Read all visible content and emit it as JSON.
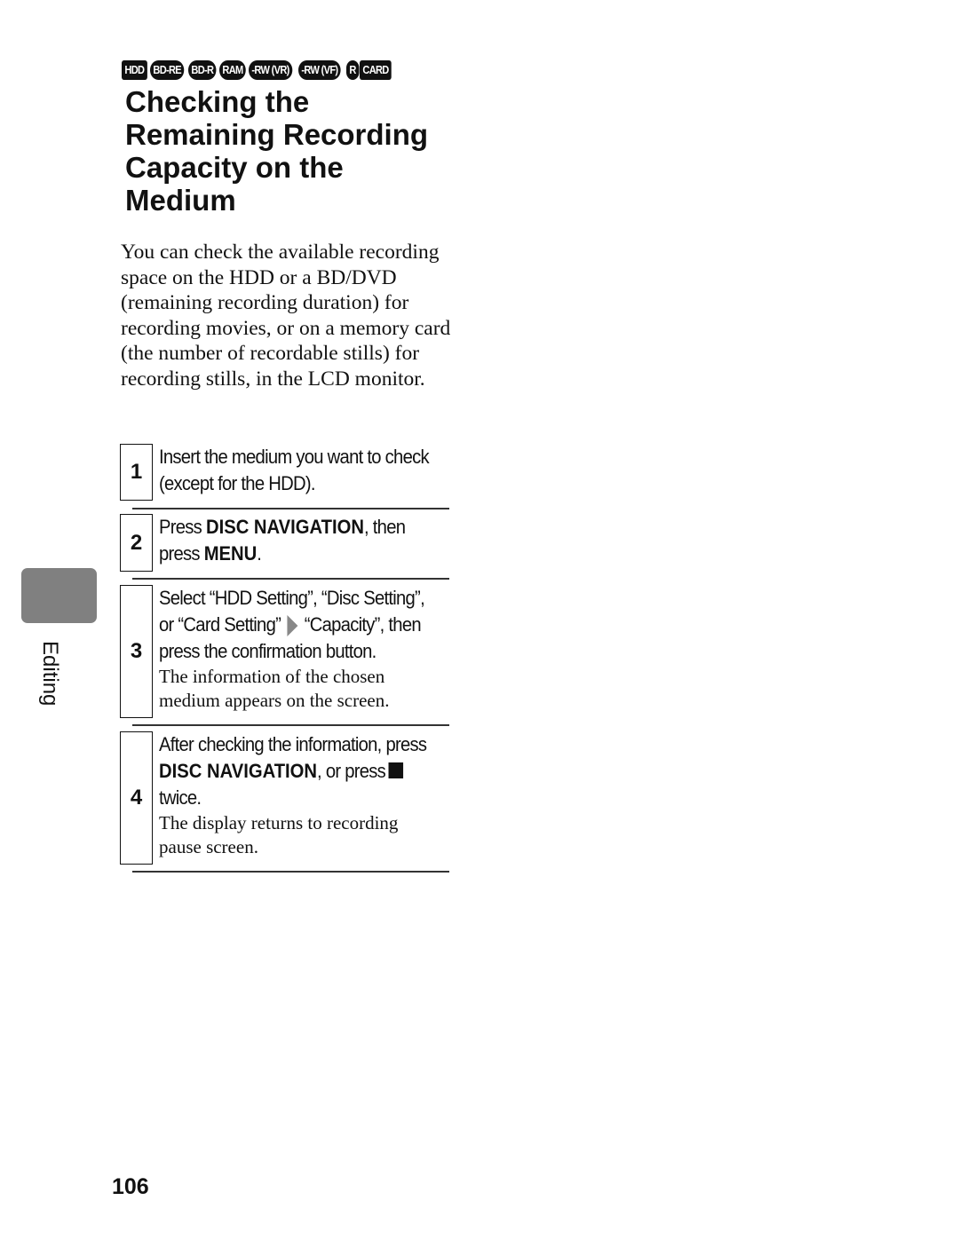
{
  "media_badges": [
    {
      "label": "HDD",
      "shape": "square"
    },
    {
      "label": "BD-RE",
      "shape": "pill"
    },
    {
      "label": "BD-R",
      "shape": "pill"
    },
    {
      "label": "RAM",
      "shape": "pill"
    },
    {
      "label": "-RW (VR)",
      "shape": "pill"
    },
    {
      "label": "-RW (VF)",
      "shape": "pill"
    },
    {
      "label": "R",
      "shape": "pill"
    },
    {
      "label": "CARD",
      "shape": "square"
    }
  ],
  "title_lines": [
    "Checking the",
    "Remaining Recording",
    "Capacity on the",
    "Medium"
  ],
  "intro": "You can check the available recording space on the HDD or a BD/DVD (remaining recording duration) for recording movies, or on a memory card (the number of recordable stills) for recording stills, in the LCD monitor.",
  "steps": [
    {
      "number": "1",
      "line1": "Insert the medium you want to check",
      "line2": "(except for the HDD)."
    },
    {
      "number": "2",
      "line1_pre": "Press ",
      "line1_bold": "DISC NAVIGATION",
      "line1_post": ", then",
      "line2_pre": "press ",
      "line2_bold": "MENU",
      "line2_post": "."
    },
    {
      "number": "3",
      "line1": "Select “HDD Setting”, “Disc Setting”,",
      "line2_pre": "or “Card Setting”",
      "line2_post": "“Capacity”, then",
      "line3": "press the confirmation button.",
      "note": "The information of the chosen medium appears on the screen."
    },
    {
      "number": "4",
      "line1": "After checking the information, press",
      "line2_bold": "DISC NAVIGATION",
      "line2_post": ", or press",
      "line3": "twice.",
      "note": "The display returns to recording pause screen."
    }
  ],
  "side_tab_label": "Editing",
  "page_number": "106"
}
